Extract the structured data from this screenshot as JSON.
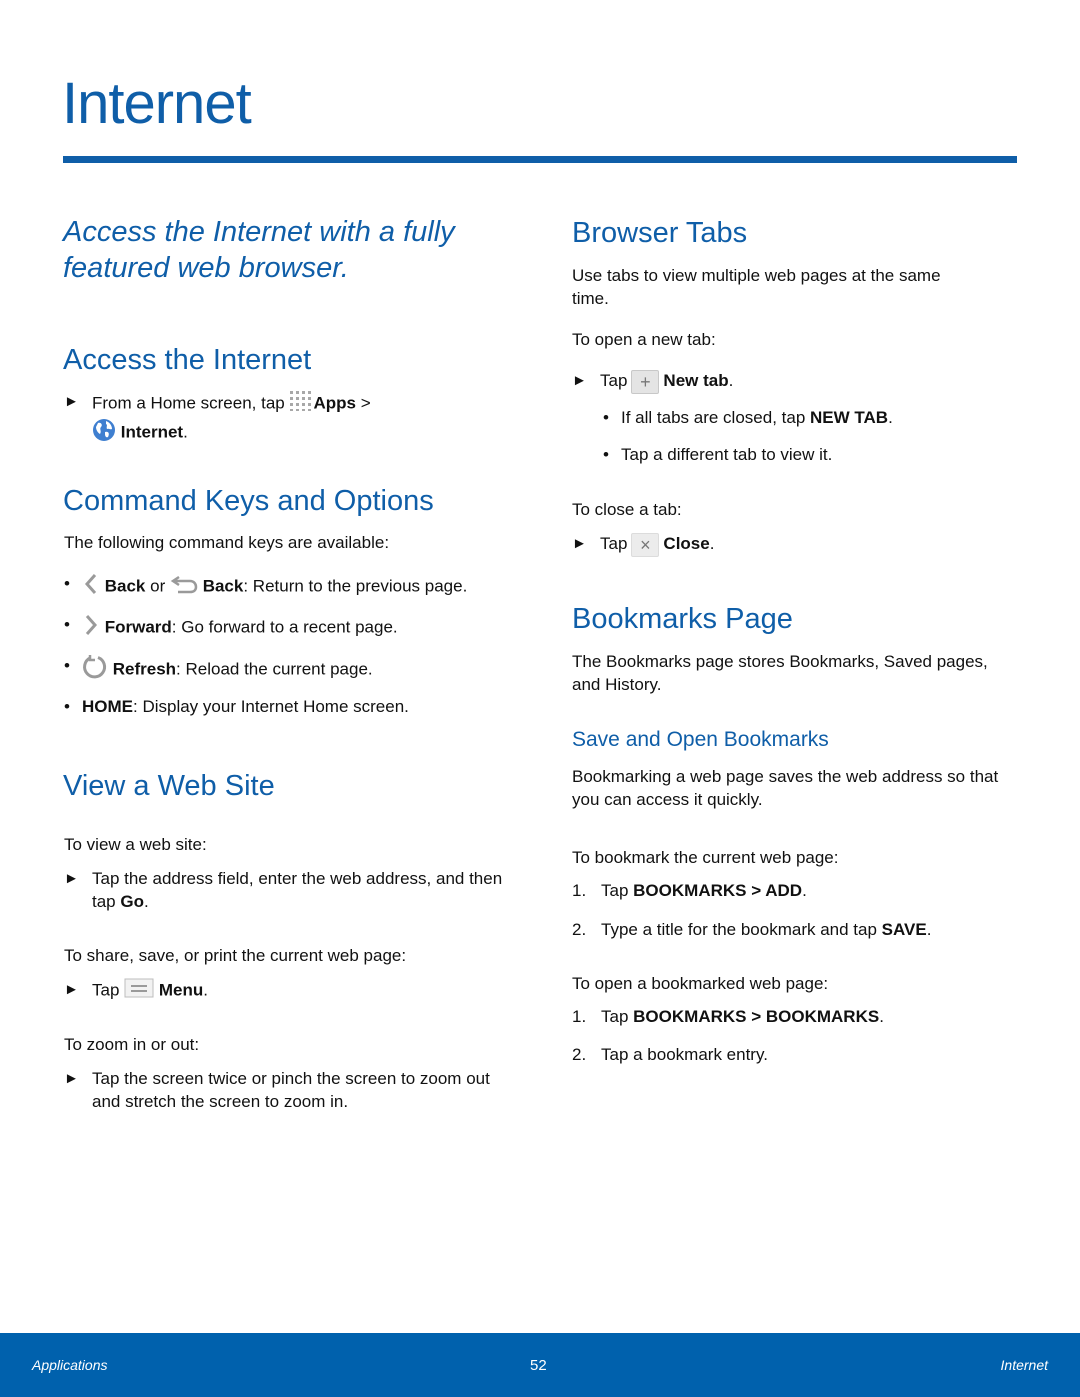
{
  "page": {
    "title": "Internet",
    "tagline": "Access the Internet with a fully featured web browser."
  },
  "left": {
    "access": {
      "heading": "Access the Internet",
      "step_prefix": "From a Home screen, tap",
      "apps_label": "Apps",
      "sep": ">",
      "internet_label": "Internet",
      "end": "."
    },
    "command_keys": {
      "heading": "Command Keys and Options",
      "intro": "The following command keys are available:",
      "items": [
        {
          "icon": "chevron-left-icon",
          "bold": "Back",
          "mid": "or",
          "icon2": "return-arrow-icon",
          "bold2": "Back",
          "rest": ": Return to the previous page."
        },
        {
          "icon": "chevron-right-icon",
          "bold": "Forward",
          "rest": ": Go forward to a recent page."
        },
        {
          "icon": "refresh-icon",
          "bold": "Refresh",
          "rest": ": Reload the current page."
        },
        {
          "bold": "HOME",
          "rest": ": Display your Internet Home screen."
        }
      ]
    },
    "view_site": {
      "heading": "View a Web Site",
      "intro1": "To view a web site:",
      "step1_text": "Tap the address field, enter the web address, and then tap",
      "step1_bold": "Go",
      "intro2": "To share, save, or print the current web page:",
      "step2_prefix": "Tap",
      "step2_bold": "Menu",
      "intro3": "To zoom in or out:",
      "step3_text": "Tap the screen twice or pinch the screen to zoom out and stretch the screen to zoom in."
    }
  },
  "right": {
    "tabs": {
      "heading": "Browser Tabs",
      "intro": "Use tabs to view multiple web pages at the same time.",
      "open_intro": "To open a new tab:",
      "open_prefix": "Tap",
      "open_bold": "New tab",
      "bullets": [
        {
          "text": "If all tabs are closed, tap",
          "bold": "NEW TAB"
        },
        {
          "text": "Tap a different tab to view it."
        }
      ],
      "close_intro": "To close a tab:",
      "close_prefix": "Tap",
      "close_bold": "Close"
    },
    "bookmarks": {
      "heading": "Bookmarks Page",
      "intro": "The Bookmarks page stores Bookmarks, Saved pages, and History.",
      "subheading": "Save and Open Bookmarks",
      "sub_intro": "Bookmarking a web page saves the web address so that you can access it quickly.",
      "save_intro": "To bookmark the current web page:",
      "save_steps": [
        {
          "n": "1.",
          "prefix": "Tap",
          "bold": "BOOKMARKS > ADD",
          "end": "."
        },
        {
          "n": "2.",
          "prefix": "Type a title for the bookmark and tap",
          "bold": "SAVE",
          "end": "."
        }
      ],
      "open_intro": "To open a bookmarked web page:",
      "open_steps": [
        {
          "n": "1.",
          "prefix": "Tap",
          "bold": "BOOKMARKS > BOOKMARKS",
          "end": "."
        },
        {
          "n": "2.",
          "prefix": "Tap a bookmark entry.",
          "bold": "",
          "end": ""
        }
      ]
    }
  },
  "footer": {
    "left": "Applications",
    "page_number": "52",
    "right": "Internet"
  },
  "symbols": {
    "arrow": "►",
    "bullet": "•",
    "period": "."
  }
}
